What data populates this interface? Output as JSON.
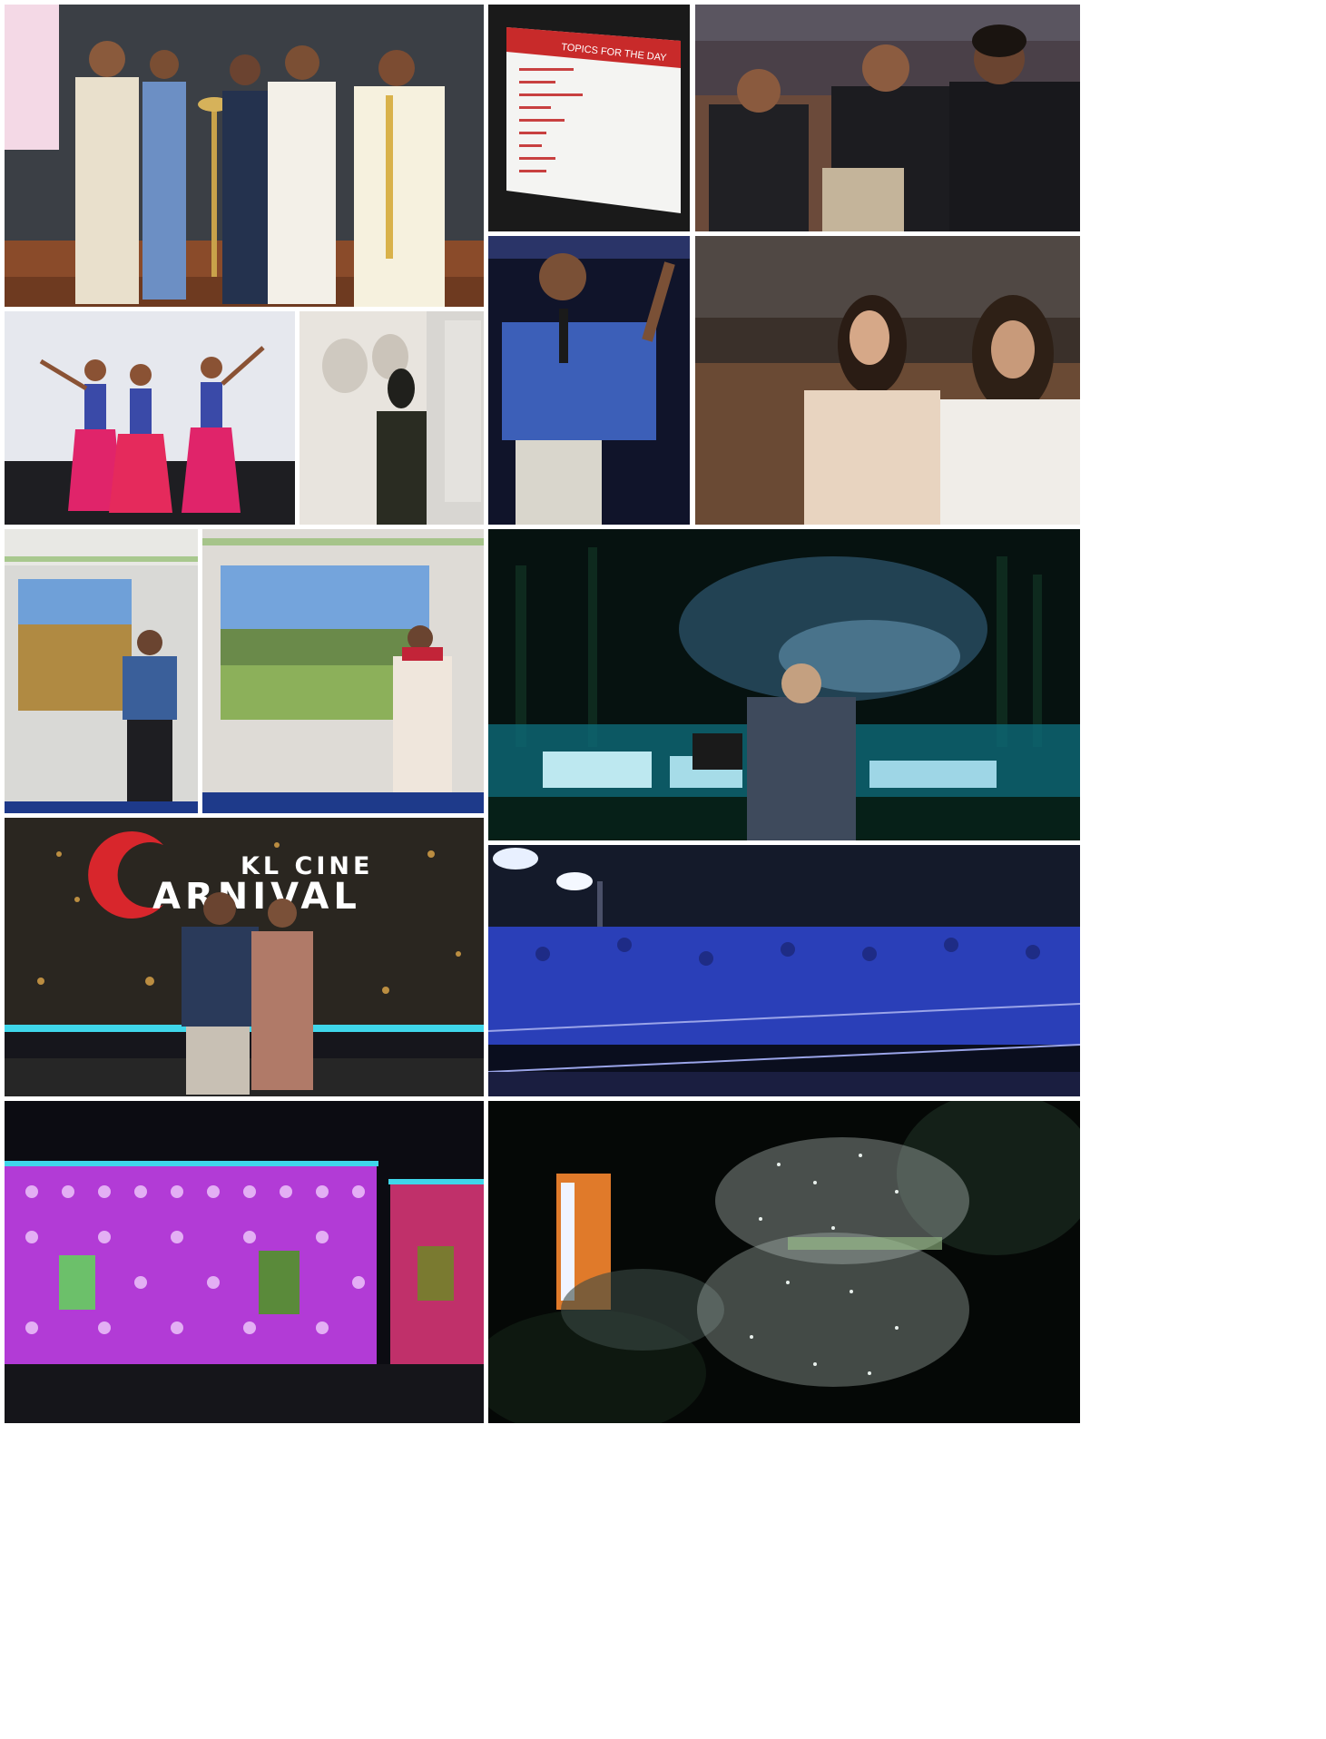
{
  "collage": {
    "panels": [
      {
        "id": "inauguration-lamp-lighting"
      },
      {
        "id": "topics-slide",
        "slide_title": "TOPICS FOR THE DAY"
      },
      {
        "id": "audience-three-men"
      },
      {
        "id": "classical-dancers"
      },
      {
        "id": "woman-speaker"
      },
      {
        "id": "man-speaker-microphone"
      },
      {
        "id": "audience-two-women"
      },
      {
        "id": "man-presenter-screen"
      },
      {
        "id": "woman-presenter-screen"
      },
      {
        "id": "dj-night-concert"
      },
      {
        "id": "kl-cine-carnival-stage",
        "logo_line1": "KL CINE",
        "logo_line2": "ARNIVAL"
      },
      {
        "id": "concert-crowd-floodlights"
      },
      {
        "id": "dancers-led-stage"
      },
      {
        "id": "aerial-night-crowd"
      }
    ]
  },
  "colors": {
    "background": "#ffffff",
    "carnival_red": "#d8262c",
    "led_purple": "#b23bd6",
    "night_cyan": "#2fd6e8",
    "concert_blue": "#2a3fb8"
  }
}
